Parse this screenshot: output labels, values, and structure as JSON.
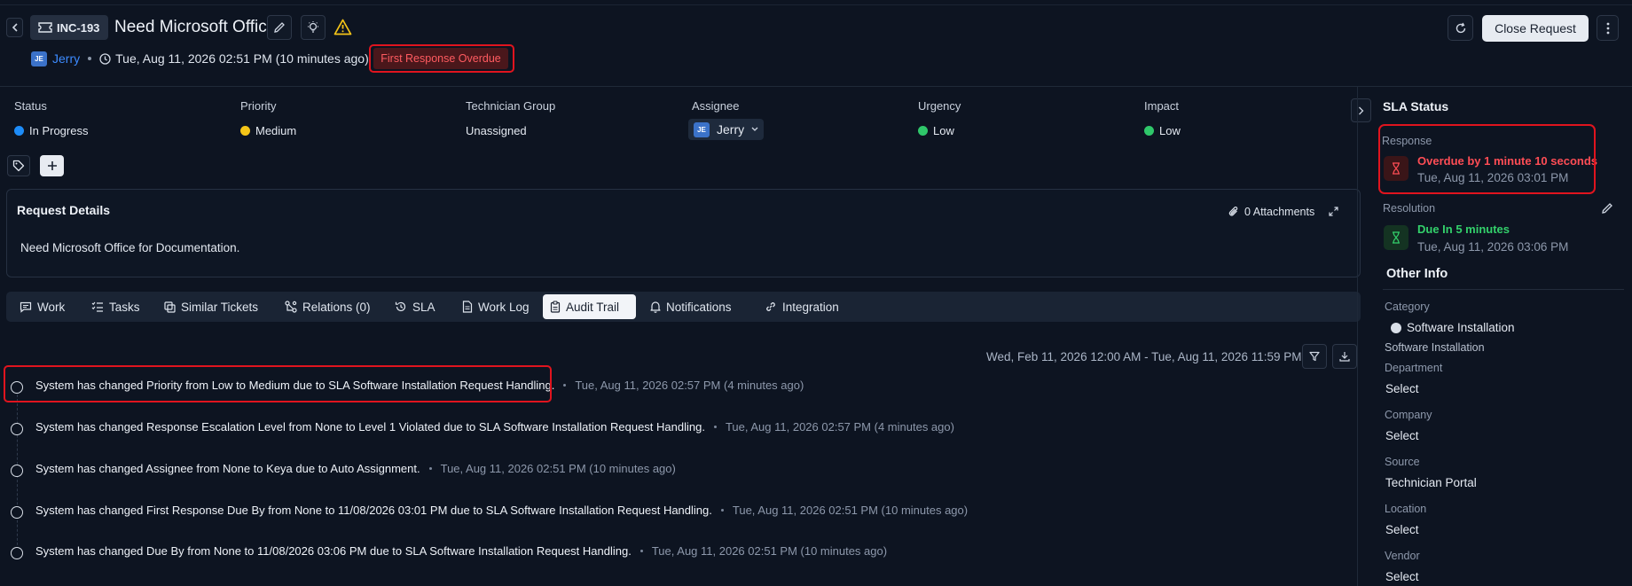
{
  "header": {
    "ticket_id": "INC-193",
    "title": "Need Microsoft Office",
    "requester_initials": "JE",
    "requester": "Jerry",
    "created": "Tue, Aug 11, 2026 02:51 PM (10 minutes ago)",
    "overdue_badge": "First Response Overdue",
    "close_label": "Close Request"
  },
  "properties": [
    {
      "label": "Status",
      "value": "In Progress",
      "dot": "#1d8cf8"
    },
    {
      "label": "Priority",
      "value": "Medium",
      "dot": "#f5c518"
    },
    {
      "label": "Technician Group",
      "value": "Unassigned"
    },
    {
      "label": "Assignee",
      "value": "Jerry",
      "initials": "JE"
    },
    {
      "label": "Urgency",
      "value": "Low",
      "dot": "#2fc76a"
    },
    {
      "label": "Impact",
      "value": "Low",
      "dot": "#2fc76a"
    }
  ],
  "request_details": {
    "title": "Request Details",
    "attachments": "0 Attachments",
    "body": "Need Microsoft Office for Documentation."
  },
  "tabs": [
    {
      "label": "Work",
      "icon": "chat-icon"
    },
    {
      "label": "Tasks",
      "icon": "checklist-icon"
    },
    {
      "label": "Similar Tickets",
      "icon": "copy-icon"
    },
    {
      "label": "Relations (0)",
      "icon": "relations-icon"
    },
    {
      "label": "SLA",
      "icon": "history-icon"
    },
    {
      "label": "Work Log",
      "icon": "document-icon"
    },
    {
      "label": "Audit Trail",
      "icon": "clipboard-icon",
      "active": true
    },
    {
      "label": "Notifications",
      "icon": "bell-icon"
    },
    {
      "label": "Integration",
      "icon": "link-icon"
    }
  ],
  "audit": {
    "date_range": "Wed, Feb 11, 2026 12:00 AM - Tue, Aug 11, 2026 11:59 PM",
    "entries": [
      {
        "message": "System has changed Priority from Low to Medium due to SLA Software Installation Request Handling.",
        "time": "Tue, Aug 11, 2026 02:57 PM (4 minutes ago)"
      },
      {
        "message": "System has changed Response Escalation Level from None to Level 1 Violated due to SLA Software Installation Request Handling.",
        "time": "Tue, Aug 11, 2026 02:57 PM (4 minutes ago)"
      },
      {
        "message": "System has changed Assignee from None to Keya due to Auto Assignment.",
        "time": "Tue, Aug 11, 2026 02:51 PM (10 minutes ago)"
      },
      {
        "message": "System has changed First Response Due By from None to 11/08/2026 03:01 PM due to SLA Software Installation Request Handling.",
        "time": "Tue, Aug 11, 2026 02:51 PM (10 minutes ago)"
      },
      {
        "message": "System has changed Due By from None to 11/08/2026 03:06 PM due to SLA Software Installation Request Handling.",
        "time": "Tue, Aug 11, 2026 02:51 PM (10 minutes ago)"
      }
    ]
  },
  "sla": {
    "title": "SLA Status",
    "response": {
      "label": "Response",
      "status": "Overdue by 1 minute 10 seconds",
      "date": "Tue, Aug 11, 2026 03:01 PM",
      "color": "#ff4d55"
    },
    "resolution": {
      "label": "Resolution",
      "status": "Due In 5 minutes",
      "date": "Tue, Aug 11, 2026 03:06 PM",
      "color": "#33d16b"
    }
  },
  "other_info": {
    "title": "Other Info",
    "category_label": "Category",
    "category_value": "Software Installation",
    "category_sub": "Software Installation",
    "fields": [
      {
        "label": "Department",
        "value": "Select"
      },
      {
        "label": "Company",
        "value": "Select"
      },
      {
        "label": "Source",
        "value": "Technician Portal"
      },
      {
        "label": "Location",
        "value": "Select"
      },
      {
        "label": "Vendor",
        "value": "Select"
      }
    ]
  },
  "colors": {
    "background": "#0d1421",
    "accent_link": "#3d8bff",
    "alert_red": "#e0141e"
  }
}
